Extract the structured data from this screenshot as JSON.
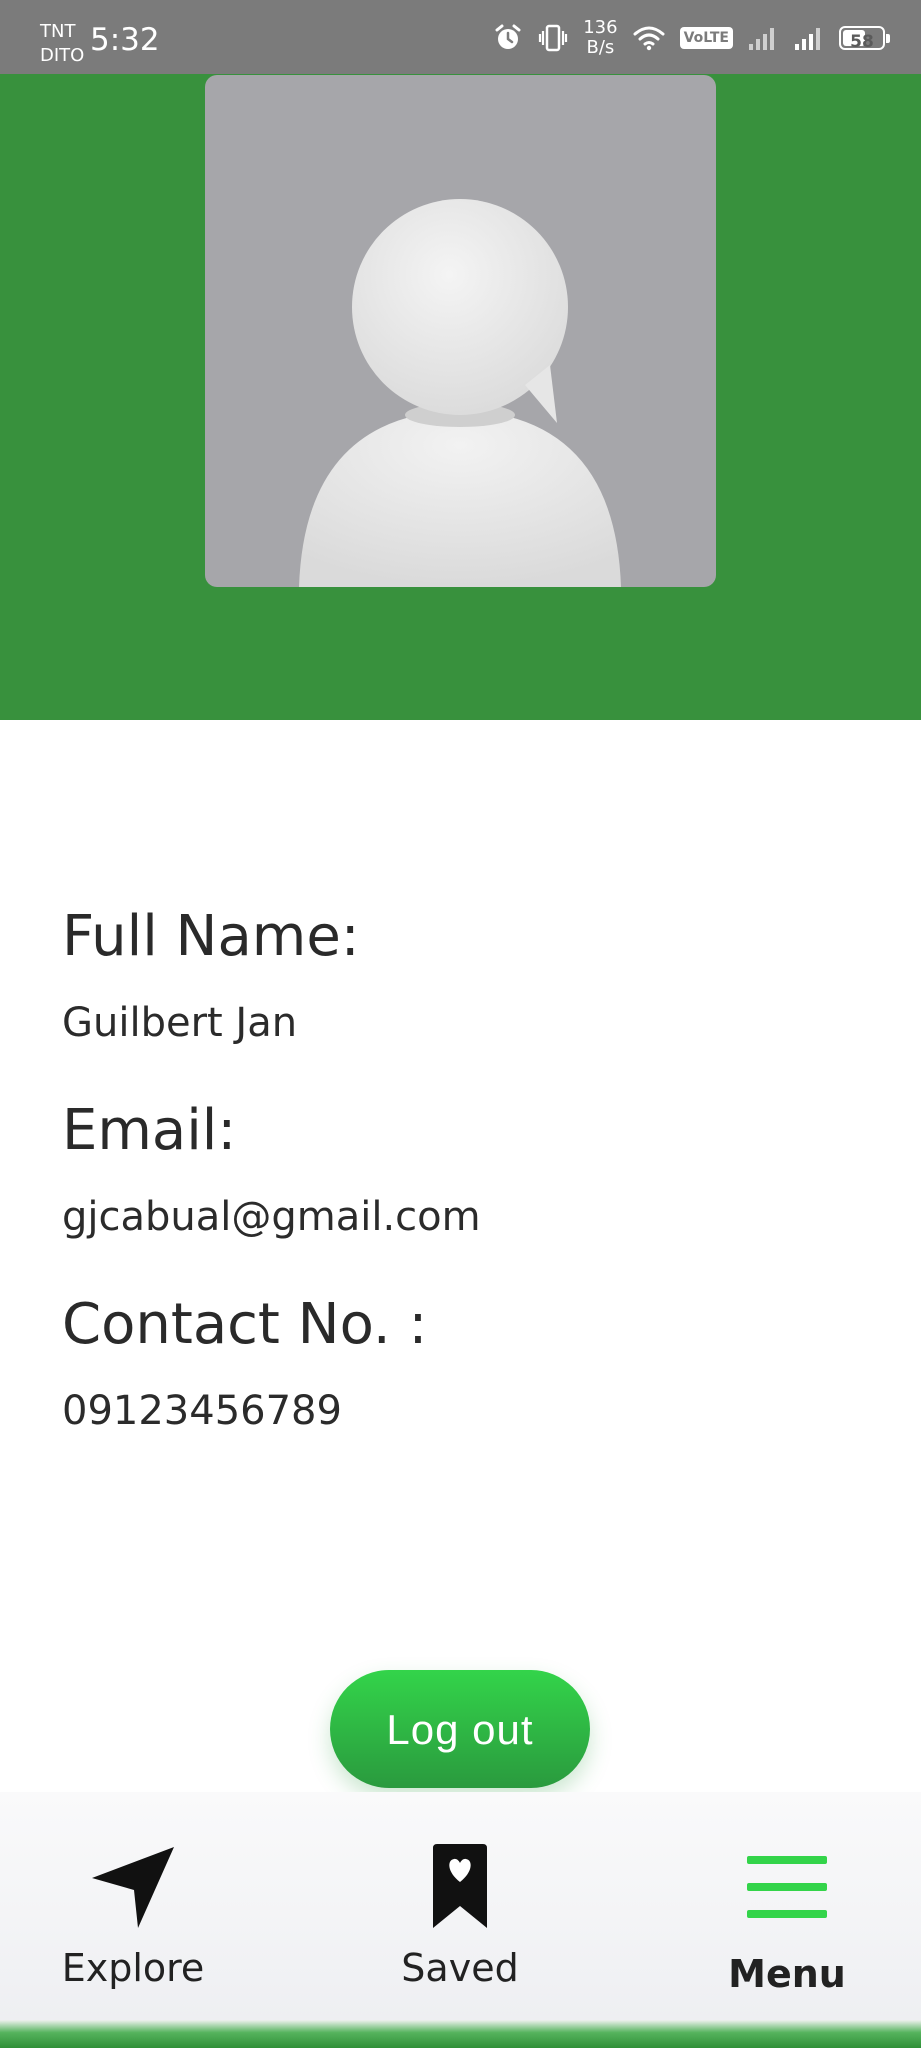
{
  "status_bar": {
    "carrier_top": "TNT",
    "carrier_bottom": "DITO",
    "time": "5:32",
    "net_speed_value": "136",
    "net_speed_unit": "B/s",
    "volte": "VoLTE",
    "battery": "58",
    "battery_level": 0.58
  },
  "profile": {
    "avatar_icon": "default-user-avatar",
    "fields": [
      {
        "label": "Full Name:",
        "value": "Guilbert Jan"
      },
      {
        "label": "Email:",
        "value": "gjcabual@gmail.com"
      },
      {
        "label": "Contact No. :",
        "value": "09123456789"
      }
    ]
  },
  "actions": {
    "logout_label": "Log out"
  },
  "bottom_nav": {
    "items": [
      {
        "label": "Explore",
        "icon": "navigation-arrow-icon"
      },
      {
        "label": "Saved",
        "icon": "bookmark-heart-icon"
      },
      {
        "label": "Menu",
        "icon": "menu-hamburger-icon",
        "active": true
      }
    ]
  },
  "colors": {
    "header_green": "#38913d",
    "accent_green": "#33d44a",
    "status_bar_gray": "#7b7b7b"
  }
}
